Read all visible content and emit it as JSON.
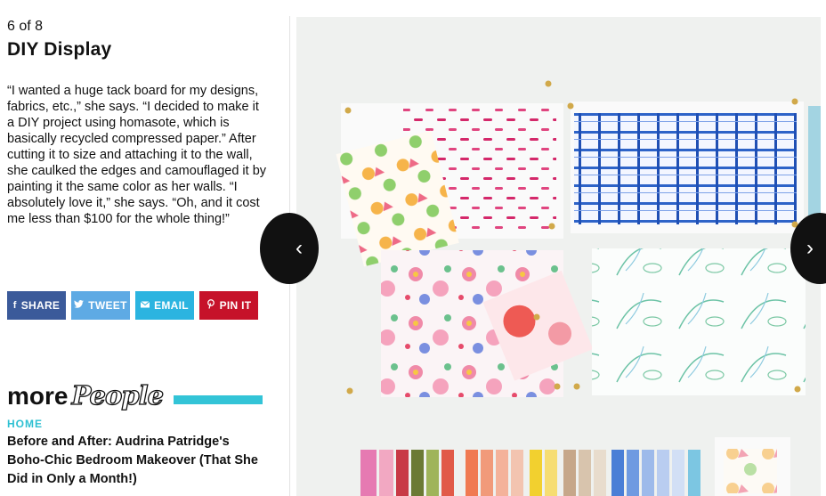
{
  "slide": {
    "counter": "6 of 8",
    "title": "DIY Display",
    "caption": "“I wanted a huge tack board for my designs, fabrics, etc.,” she says. “I decided to make it a DIY project using homasote, which is basically recycled compressed paper.” After cutting it to size and attaching it to the wall, she caulked the edges and camouflaged it by painting it the same color as her walls. “I absolutely love it,” she says. “Oh, and it cost me less than $100 for the whole thing!”"
  },
  "share": {
    "share_label": "SHARE",
    "tweet_label": "TWEET",
    "email_label": "EMAIL",
    "pin_label": "PIN IT",
    "share_icon": "facebook-icon",
    "tweet_icon": "twitter-icon",
    "email_icon": "envelope-icon",
    "pin_icon": "pinterest-icon",
    "colors": {
      "share": "#3b5a9a",
      "tweet": "#5eaae4",
      "email": "#2bb4e0",
      "pin": "#c6122a"
    }
  },
  "more": {
    "word": "more",
    "brand": "People",
    "accent": "#33c4d7"
  },
  "related": {
    "kicker": "HOME",
    "headline": "Before and After: Audrina Patridge's Boho-Chic Bedroom Makeover (That She Did in Only a Month!)"
  },
  "nav": {
    "prev_icon": "chevron-left-icon",
    "prev_glyph": "‹",
    "next_icon": "chevron-right-icon",
    "next_glyph": "›"
  }
}
